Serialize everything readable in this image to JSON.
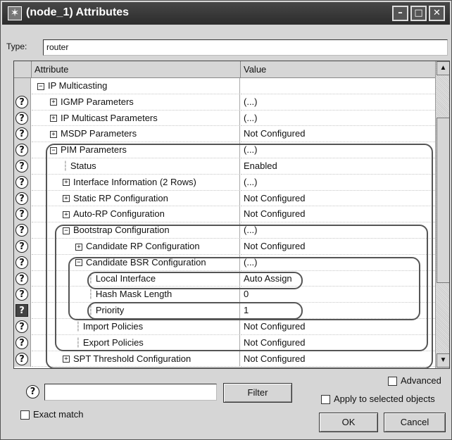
{
  "window": {
    "title": "(node_1) Attributes",
    "icon": "star-icon",
    "buttons": [
      "minimize-icon",
      "maximize-icon",
      "close-icon"
    ]
  },
  "type_field": {
    "label": "Type:",
    "value": "router"
  },
  "table": {
    "headers": [
      "Attribute",
      "Value"
    ],
    "rows": [
      {
        "depth": 0,
        "expander": "minus",
        "label": "IP Multicasting",
        "value": "",
        "q": false
      },
      {
        "depth": 1,
        "expander": "plus",
        "label": "IGMP Parameters",
        "value": "(...)",
        "q": true
      },
      {
        "depth": 1,
        "expander": "plus",
        "label": "IP Multicast Parameters",
        "value": "(...)",
        "q": true
      },
      {
        "depth": 1,
        "expander": "plus",
        "label": "MSDP Parameters",
        "value": "Not Configured",
        "q": true
      },
      {
        "depth": 1,
        "expander": "minus",
        "label": "PIM Parameters",
        "value": "(...)",
        "q": true
      },
      {
        "depth": 2,
        "expander": "line",
        "label": "Status",
        "value": "Enabled",
        "q": true
      },
      {
        "depth": 2,
        "expander": "plus",
        "label": "Interface Information (2 Rows)",
        "value": "(...)",
        "q": true
      },
      {
        "depth": 2,
        "expander": "plus",
        "label": "Static RP Configuration",
        "value": "Not Configured",
        "q": true
      },
      {
        "depth": 2,
        "expander": "plus",
        "label": "Auto-RP Configuration",
        "value": "Not Configured",
        "q": true
      },
      {
        "depth": 2,
        "expander": "minus",
        "label": "Bootstrap Configuration",
        "value": "(...)",
        "q": true
      },
      {
        "depth": 3,
        "expander": "plus",
        "label": "Candidate RP Configuration",
        "value": "Not Configured",
        "q": true
      },
      {
        "depth": 3,
        "expander": "minus",
        "label": "Candidate BSR Configuration",
        "value": "(...)",
        "q": true
      },
      {
        "depth": 4,
        "expander": "line",
        "label": "Local Interface",
        "value": "Auto Assign",
        "q": true
      },
      {
        "depth": 4,
        "expander": "line",
        "label": "Hash Mask Length",
        "value": "0",
        "q": true
      },
      {
        "depth": 4,
        "expander": "line",
        "label": "Priority",
        "value": "1",
        "q": true,
        "selected": true
      },
      {
        "depth": 3,
        "expander": "line",
        "label": "Import Policies",
        "value": "Not Configured",
        "q": true
      },
      {
        "depth": 3,
        "expander": "line",
        "label": "Export Policies",
        "value": "Not Configured",
        "q": true
      },
      {
        "depth": 2,
        "expander": "plus",
        "label": "SPT Threshold Configuration",
        "value": "Not Configured",
        "q": true
      }
    ]
  },
  "bottom": {
    "help_icon": "?",
    "filter_placeholder": "",
    "filter_button": "Filter",
    "exact_match": "Exact match",
    "advanced": "Advanced",
    "apply_selected": "Apply to selected objects",
    "ok": "OK",
    "cancel": "Cancel"
  }
}
